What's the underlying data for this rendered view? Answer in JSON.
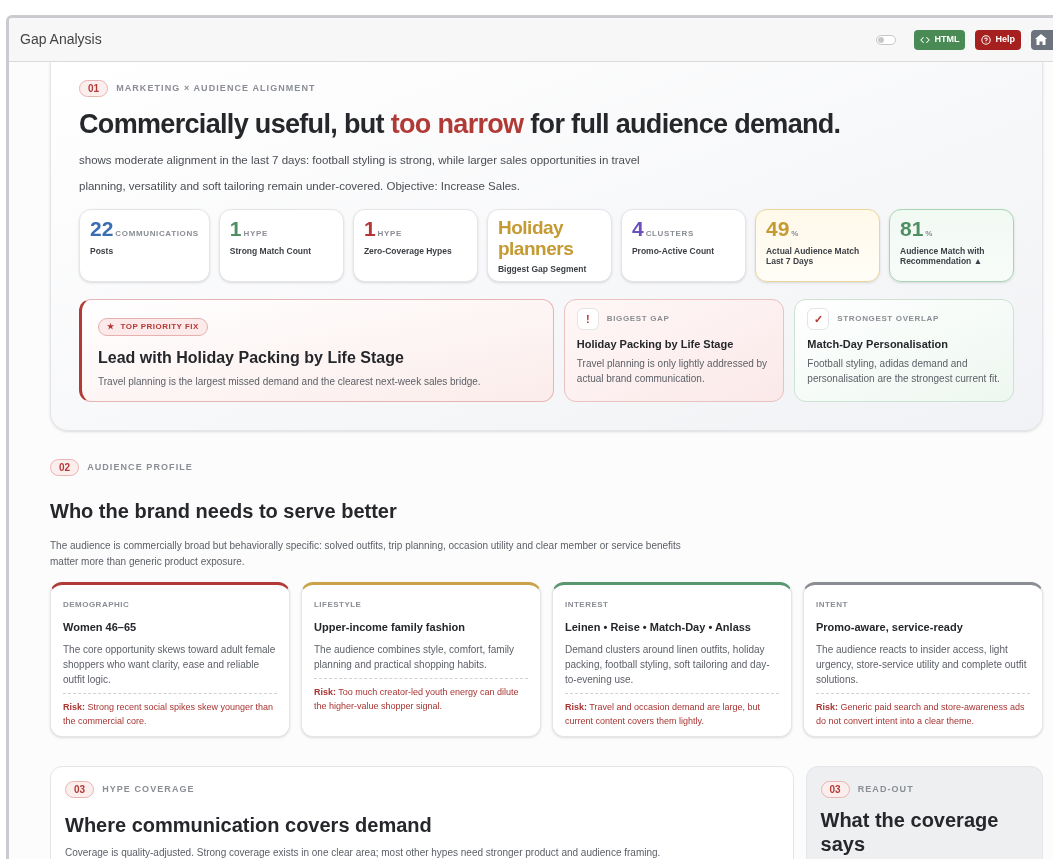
{
  "window": {
    "title": "Gap Analysis"
  },
  "toolbar": {
    "toggle": {
      "on": false
    },
    "buttons": [
      {
        "kind": "html",
        "label": "HTML"
      },
      {
        "kind": "help",
        "label": "Help"
      },
      {
        "kind": "home"
      }
    ]
  },
  "section1": {
    "number": "01",
    "eyebrow": "MARKETING × AUDIENCE ALIGNMENT",
    "headline": {
      "before": "Commercially useful, but ",
      "highlight": "too narrow",
      "after": " for full audience demand."
    },
    "description": "shows moderate alignment in the last 7 days: football styling is strong, while larger sales opportunities in travel planning, versatility and soft tailoring remain under-covered. Objective: Increase Sales.",
    "stats": [
      {
        "kind": "plain",
        "value": "22",
        "unit": "COMMUNICATIONS",
        "label": "Posts",
        "color": "#3b6db3"
      },
      {
        "kind": "plain",
        "value": "1",
        "unit": "HYPE",
        "label": "Strong Match Count",
        "color": "#4e8f63"
      },
      {
        "kind": "plain",
        "value": "1",
        "unit": "HYPE",
        "label": "Zero-Coverage Hypes",
        "color": "#b83434"
      },
      {
        "kind": "plain",
        "value": "Holiday planners",
        "label": "Biggest Gap Segment",
        "color": "#c49a32"
      },
      {
        "kind": "plain",
        "value": "4",
        "unit": "CLUSTERS",
        "label": "Promo-Active Count",
        "color": "#6a4fbd"
      },
      {
        "kind": "warm",
        "value": "49",
        "unit": "%",
        "label": "Actual Audience Match Last 7 Days",
        "color": "#c49a32"
      },
      {
        "kind": "positive",
        "value": "81",
        "unit": "%",
        "label": "Audience Match with Recommendation ▲",
        "color": "#4e8f63"
      }
    ],
    "highlights": [
      {
        "kind": "priority",
        "badge": "TOP PRIORITY FIX",
        "badge_icon": "★",
        "title": "Lead with Holiday Packing by Life Stage",
        "text": "Travel planning is the largest missed demand and the clearest next-week sales bridge."
      },
      {
        "kind": "gap",
        "icon": "!",
        "eyebrow": "BIGGEST GAP",
        "title": "Holiday Packing by Life Stage",
        "text": "Travel planning is only lightly addressed by actual brand communication."
      },
      {
        "kind": "overlap",
        "icon": "✓",
        "eyebrow": "STRONGEST OVERLAP",
        "title": "Match-Day Personalisation",
        "text": "Football styling, adidas demand and personalisation are the strongest current fit."
      }
    ]
  },
  "section2": {
    "number": "02",
    "eyebrow": "AUDIENCE PROFILE",
    "heading": "Who the brand needs to serve better",
    "description": "The audience is commercially broad but behaviorally specific: solved outfits, trip planning, occasion utility and clear member or service benefits matter more than generic product exposure.",
    "cards": [
      {
        "category": "DEMOGRAPHIC",
        "title": "Women 46–65",
        "text": "The core opportunity skews toward adult female shoppers who want clarity, ease and reliable outfit logic.",
        "risk": "**Risk:** Strong recent social spikes skew younger than the commercial core.",
        "color": "#b03a36"
      },
      {
        "category": "LIFESTYLE",
        "title": "Upper-income family fashion",
        "text": "The audience combines style, comfort, family planning and practical shopping habits.",
        "risk": "**Risk:** Too much creator-led youth energy can dilute the higher-value shopper signal.",
        "color": "#c9a24a"
      },
      {
        "category": "INTEREST",
        "title": "Leinen • Reise • Match-Day • Anlass",
        "text": "Demand clusters around linen outfits, holiday packing, football styling, soft tailoring and day-to-evening use.",
        "risk": "**Risk:** Travel and occasion demand are large, but current content covers them lightly.",
        "color": "#5a9670"
      },
      {
        "category": "INTENT",
        "title": "Promo-aware, service-ready",
        "text": "The audience reacts to insider access, light urgency, store-service utility and complete outfit solutions.",
        "risk": "**Risk:** Generic paid search and store-awareness ads do not convert intent into a clear theme.",
        "color": "#8a8d94"
      }
    ]
  },
  "section3": {
    "number": "03",
    "eyebrow": "HYPE COVERAGE",
    "heading": "Where communication covers demand",
    "description": "Coverage is quality-adjusted. Strong coverage exists in one clear area; most other hypes need stronger product and audience framing."
  },
  "readout": {
    "number": "03",
    "eyebrow": "READ-OUT",
    "heading": "What the coverage says"
  }
}
